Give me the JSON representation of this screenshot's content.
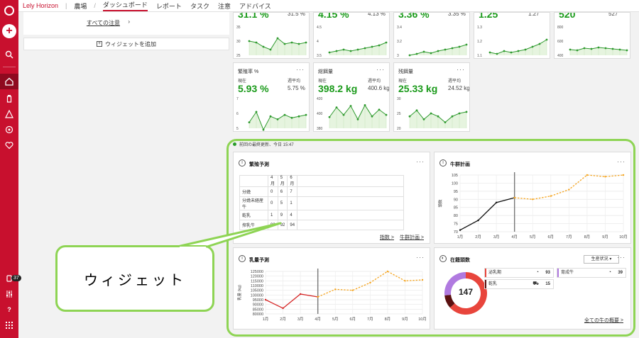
{
  "topnav": {
    "brand": "Lely Horizon",
    "farm": "農場",
    "items": [
      "ダッシュボード",
      "レポート",
      "タスク",
      "注意",
      "アドバイス"
    ]
  },
  "sidebar": {
    "badge": "37"
  },
  "left": {
    "all_alerts": "すべての注意",
    "add_widget": "ウィジェットを追加"
  },
  "colors": {
    "brand_red": "#c8102e",
    "kpi_green": "#1a9a1a",
    "highlight_green": "#8ed454",
    "line_orange": "#f5a623"
  },
  "kpis_top": [
    {
      "cur": "31.1 %",
      "avg": "31.5 %",
      "y_ticks": [
        "35",
        "30",
        "25"
      ],
      "values": [
        30,
        29.5,
        28,
        27,
        31,
        29,
        29.5,
        29,
        29.5
      ]
    },
    {
      "cur": "4.15 %",
      "avg": "4.13 %",
      "y_ticks": [
        "4.5",
        "4",
        "3.5"
      ],
      "values": [
        3.6,
        3.65,
        3.7,
        3.65,
        3.7,
        3.75,
        3.8,
        3.85,
        3.95
      ]
    },
    {
      "cur": "3.36 %",
      "avg": "3.35 %",
      "y_ticks": [
        "3.4",
        "3.2",
        "3"
      ],
      "values": [
        3.0,
        3.02,
        3.05,
        3.03,
        3.06,
        3.08,
        3.1,
        3.12,
        3.15
      ]
    },
    {
      "cur": "1.25",
      "avg": "1.27",
      "y_ticks": [
        "1.3",
        "1.2",
        "1.1"
      ],
      "values": [
        1.12,
        1.11,
        1.13,
        1.12,
        1.13,
        1.14,
        1.16,
        1.18,
        1.21
      ]
    },
    {
      "cur": "520",
      "avg": "527",
      "y_ticks": [
        "800",
        "600",
        "400"
      ],
      "values": [
        480,
        470,
        500,
        490,
        510,
        500,
        490,
        480,
        470
      ]
    }
  ],
  "kpis": [
    {
      "title": "繁殖率 %",
      "cur_label": "現在",
      "avg_label": "週平均",
      "cur": "5.93 %",
      "avg": "5.75 %",
      "y_ticks": [
        "7",
        "6",
        "5"
      ],
      "values": [
        5.4,
        6.1,
        4.9,
        5.8,
        5.6,
        5.9,
        5.7,
        5.8,
        5.9
      ]
    },
    {
      "title": "総餌量",
      "cur_label": "現在",
      "avg_label": "週平均",
      "cur": "398.2 kg",
      "avg": "400.6 kg",
      "y_ticks": [
        "420",
        "400",
        "380"
      ],
      "values": [
        395,
        408,
        398,
        410,
        392,
        411,
        396,
        405,
        398
      ]
    },
    {
      "title": "残餌量",
      "cur_label": "現在",
      "avg_label": "週平均",
      "cur": "25.33 kg",
      "avg": "24.52 kg",
      "y_ticks": [
        "30",
        "25",
        "20"
      ],
      "values": [
        24,
        26,
        23,
        25,
        24,
        22,
        24,
        25,
        25.5
      ]
    }
  ],
  "status": "前回の最終更新、今日 15:47",
  "calving": {
    "title": "繁殖予測",
    "months": [
      "4月",
      "5月",
      "6月"
    ],
    "rows": [
      {
        "label": "分娩",
        "values": [
          "0",
          "6",
          "7"
        ]
      },
      {
        "label": "分娩未経産牛",
        "values": [
          "0",
          "5",
          "1"
        ]
      },
      {
        "label": "乾乳",
        "values": [
          "1",
          "9",
          "4"
        ]
      },
      {
        "label": "搾乳牛",
        "values": [
          "93",
          "92",
          "94"
        ]
      }
    ],
    "links": [
      "指数 >",
      "牛群計画 >"
    ]
  },
  "herd_plan": {
    "title": "牛群計画",
    "chart_data": {
      "type": "line",
      "x": [
        "1月",
        "2月",
        "3月",
        "4月",
        "5月",
        "6月",
        "7月",
        "8月",
        "9月",
        "10月"
      ],
      "series": [
        {
          "values": [
            71,
            77,
            88,
            91,
            null,
            null,
            null,
            null,
            null,
            null
          ]
        },
        {
          "values": [
            null,
            null,
            null,
            91,
            90,
            92,
            96,
            105,
            104,
            105
          ]
        }
      ],
      "ylabel": "頭数",
      "y_ticks": [
        "105",
        "100",
        "95",
        "90",
        "85",
        "80",
        "75",
        "70"
      ],
      "ylim": [
        70,
        105
      ]
    }
  },
  "milk": {
    "title": "乳量予測",
    "chart_data": {
      "type": "line",
      "x": [
        "1月",
        "2月",
        "3月",
        "4月",
        "5月",
        "6月",
        "7月",
        "8月",
        "9月",
        "10月"
      ],
      "series": [
        {
          "values": [
            95000,
            86000,
            101000,
            98000,
            null,
            null,
            null,
            null,
            null,
            null
          ]
        },
        {
          "values": [
            null,
            null,
            null,
            98000,
            106000,
            105000,
            113000,
            125000,
            115000,
            116000
          ]
        }
      ],
      "ylabel": "乳量 (kg)",
      "y_ticks": [
        "125000",
        "120000",
        "115000",
        "110000",
        "105000",
        "100000",
        "95000",
        "90000",
        "85000",
        "80000"
      ],
      "ylim": [
        80000,
        125000
      ]
    }
  },
  "herd": {
    "title": "在籍頭数",
    "select": "生産状況 ▾",
    "total": "147",
    "chart_data": {
      "type": "pie",
      "segments": [
        {
          "label": "泌乳期",
          "value": 93,
          "color": "#e8453c"
        },
        {
          "label": "乾乳",
          "value": 15,
          "color": "#5a1010"
        },
        {
          "label": "育成牛",
          "value": 39,
          "color": "#b07ae0"
        }
      ]
    },
    "link": "全ての牛の概要 >"
  },
  "callout": "ウィジェット"
}
